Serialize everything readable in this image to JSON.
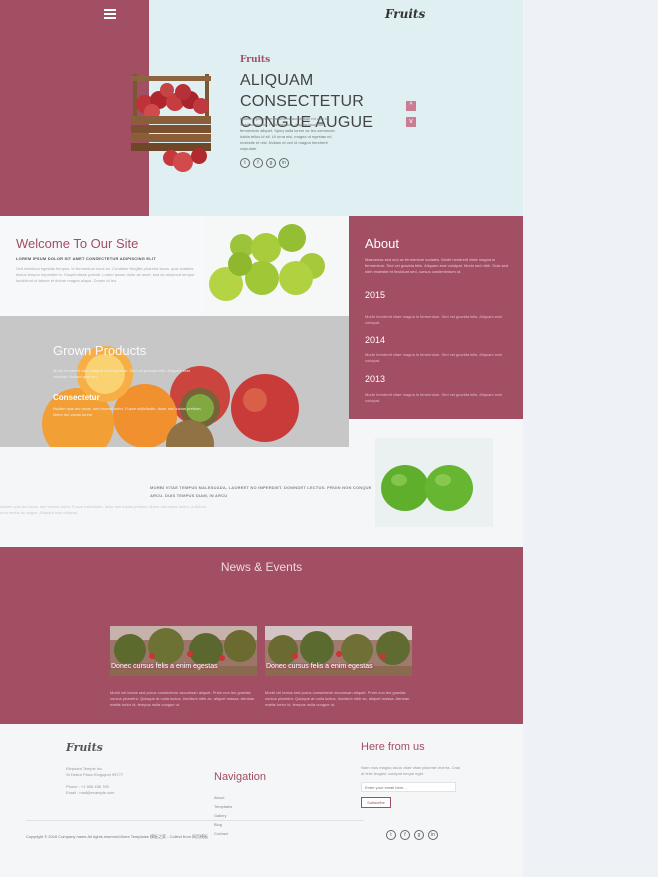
{
  "header": {
    "logo": "Fruits",
    "menu_icon": "hamburger-menu-icon"
  },
  "hero": {
    "kicker": "Fruits",
    "title": "ALIQUAM CONSECTETUR CONGUE AUGUE",
    "text": "Ullamcorper etiam mauris in, accumsan mi odio id. Vestibulum orci. Proin pretium, sapien faucibus fermentum aliquet. Speq nulla lorem ac leo commodo habia tellus id sit. Ut urna nisi, magna ut egestas mi, molestie et nisl. Nullam et orci id magna hendrerit vulputate.",
    "social": [
      "t",
      "f",
      "g",
      "in"
    ],
    "arrow_up": "^",
    "arrow_down": "v"
  },
  "welcome": {
    "title": "Welcome To Our Site",
    "subtitle": "LOREM IPSUM DOLOR SIT AMET CONSECTETUR ADIPISCING ELIT",
    "text": "Sed interdum egestas tempus. In fermentum risus eu. Curabitur fringilla pharetra lacus, quis sodales lectus tempor imperdiet in. Suspendisse potenti. Lorem ipsum dolor sit amet, sed do eiusmod tempor incididunt ut labore et dolore magna aliqua. Donec ut leo."
  },
  "about": {
    "title": "About",
    "intro": "Maecenas sed orci ac fermentum sodales. Morbi hendrerit vitae magna in fermentum. Sed vel gravida felis. Aliquam erat volutpat. Morbi sed nibh. Duis sed nibh molestie et tincidunt sed, cursus condimentum ut.",
    "years": [
      {
        "year": "2015",
        "text": "Morbi hendrerit vitae magna in fermentum. Sed vel gravida felis. Aliquam erat volutpat."
      },
      {
        "year": "2014",
        "text": "Morbi hendrerit vitae magna in fermentum. Sed vel gravida felis. Aliquam erat volutpat."
      },
      {
        "year": "2013",
        "text": "Morbi hendrerit vitae magna in fermentum. Sed vel gravida felis. Aliquam erat volutpat."
      }
    ]
  },
  "grown": {
    "title": "Grown Products",
    "text": "Morbi hendrerit vitae magna in fermentum. Sed vel gravida felis. Aliquam erat volutpat. Nullam quis leo.",
    "subtitle": "Consectetur",
    "text2": "Nullam quis leo lacus, sed viverra tortor. Fusce sollicitudin, dolor non luctus pretium, libero dui varius lorem."
  },
  "mid": {
    "text": "MORBI VITAE TEMPUS MALESUADA, LAOREET NO IMPERDIET. DOWNDET LECTUS. PROIN NON CONQUE ARCU. DUIS TEMPUS DIAM, IN ARCU",
    "faint": "Nullam quis leo lacus, sed viverra tortor. Fusce sollicitudin, dolor non luctus pretium, libero dui varius lorem, a dictum eros metus ac augue. Aliquam erat volutpat."
  },
  "news": {
    "title": "News & Events",
    "cards": [
      {
        "caption": "Donec cursus felis a enim egestas",
        "text": "Morbi vel lectus sed purus consectetur accumsan aliquet. Proin non leo gravida cursus pharetra. Quisque at nulla luctus, tincidunt nibh ac, aliquet massa. Aenean mattis tortor id, tempus nulla congue ut."
      },
      {
        "caption": "Donec cursus felis a enim egestas",
        "text": "Morbi vel lectus sed purus consectetur accumsan aliquet. Proin non leo gravida cursus pharetra. Quisque at nulla luctus, tincidunt nibh ac, aliquet massa. Aenean mattis tortor id, tempus nulla congue ut."
      }
    ]
  },
  "footer": {
    "logo": "Fruits",
    "address": [
      "Elephant Temple Inc.",
      "St Debra Place,Kingsport 95777"
    ],
    "phone": [
      "Phone : +1 555 456 789",
      "Email : mail@example.com"
    ],
    "nav_title": "Navigation",
    "nav_items": [
      "About",
      "Templates",
      "Gallery",
      "Blog",
      "Contact"
    ],
    "here_title": "Here from us",
    "here_text": "Nam mus magna lacus vitae vitae placerat viverra. Cras at felis feugiat, volutpat neque eget.",
    "email_placeholder": "Enter your email here...",
    "subscribe_label": "Subscribe",
    "copyright": "Copyright © 2016 Company name All rights reserved.More Templates 模板之家 - Collect from 网页模板",
    "social": [
      "t",
      "f",
      "g",
      "in"
    ]
  },
  "colors": {
    "brand": "#a24e63",
    "hero_bg": "#dfeff2",
    "page_bg": "#f4f6f8"
  }
}
